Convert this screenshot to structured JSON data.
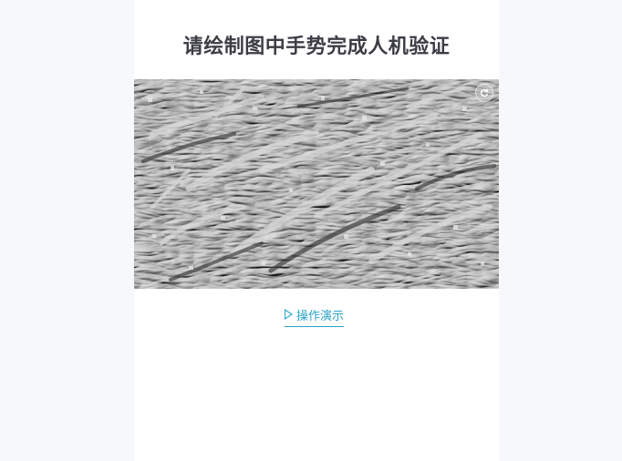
{
  "captcha": {
    "title": "请绘制图中手势完成人机验证",
    "demo_label": "操作演示",
    "refresh_icon": "refresh-icon",
    "play_icon": "play-icon"
  }
}
